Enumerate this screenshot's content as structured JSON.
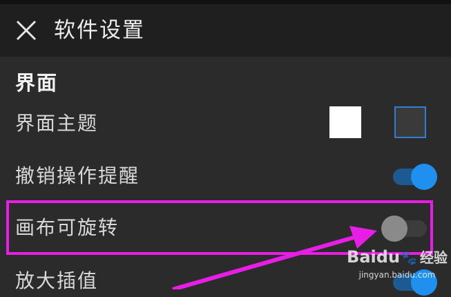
{
  "header": {
    "title": "软件设置"
  },
  "section": {
    "title": "界面"
  },
  "settings": [
    {
      "label": "界面主题",
      "options": [
        "light",
        "dark"
      ],
      "selected": "dark"
    },
    {
      "label": "撤销操作提醒",
      "toggle": true
    },
    {
      "label": "画布可旋转",
      "toggle": false
    },
    {
      "label": "放大插值",
      "toggle": true
    }
  ],
  "watermark": {
    "brand": "Baidu",
    "subtitle": "经验",
    "url": "jingyan.baidu.com"
  },
  "colors": {
    "background": "#2b2b2b",
    "header": "#1f1f1f",
    "toggle_on": "#1f90f0",
    "highlight": "#e81ee6"
  },
  "icons": {
    "close": "close-icon",
    "arrow": "annotation-arrow"
  }
}
